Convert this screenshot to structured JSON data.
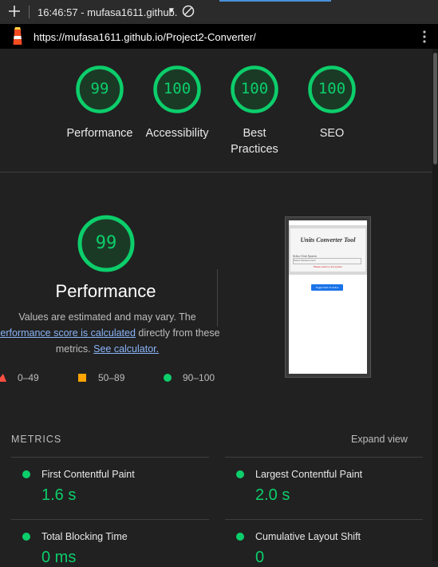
{
  "toolbar": {
    "title": "16:46:57 - mufasa1611.github.",
    "caret": "▼"
  },
  "urlbar": {
    "url": "https://mufasa1611.github.io/Project2-Converter/"
  },
  "colors": {
    "pass": "#0cce6b",
    "average": "#ffa400",
    "fail": "#ff4e42",
    "link": "#8ab4f8"
  },
  "gauges": [
    {
      "label": "Performance",
      "score": "99"
    },
    {
      "label": "Accessibility",
      "score": "100"
    },
    {
      "label": "Best",
      "label2": "Practices",
      "score": "100"
    },
    {
      "label": "SEO",
      "score": "100"
    }
  ],
  "performance": {
    "score": "99",
    "title": "Performance",
    "desc1": "Values are estimated and may vary. The",
    "desc_link": "performance score is calculated",
    "desc2": "directly from these",
    "desc3": "metrics.",
    "calc_link": "See calculator."
  },
  "legend": {
    "fail": "0–49",
    "average": "50–89",
    "pass": "90–100"
  },
  "thumbnail": {
    "title": "Units Converter Tool",
    "select_label": "Select Unit System",
    "select_value": "Select Measurement",
    "error": "Please select a unit system",
    "button": "Toggle Dark To Active"
  },
  "metrics": {
    "heading": "METRICS",
    "expand": "Expand view",
    "items": [
      {
        "label": "First Contentful Paint",
        "value": "1.6 s"
      },
      {
        "label": "Largest Contentful Paint",
        "value": "2.0 s"
      },
      {
        "label": "Total Blocking Time",
        "value": "0 ms"
      },
      {
        "label": "Cumulative Layout Shift",
        "value": "0"
      }
    ]
  }
}
